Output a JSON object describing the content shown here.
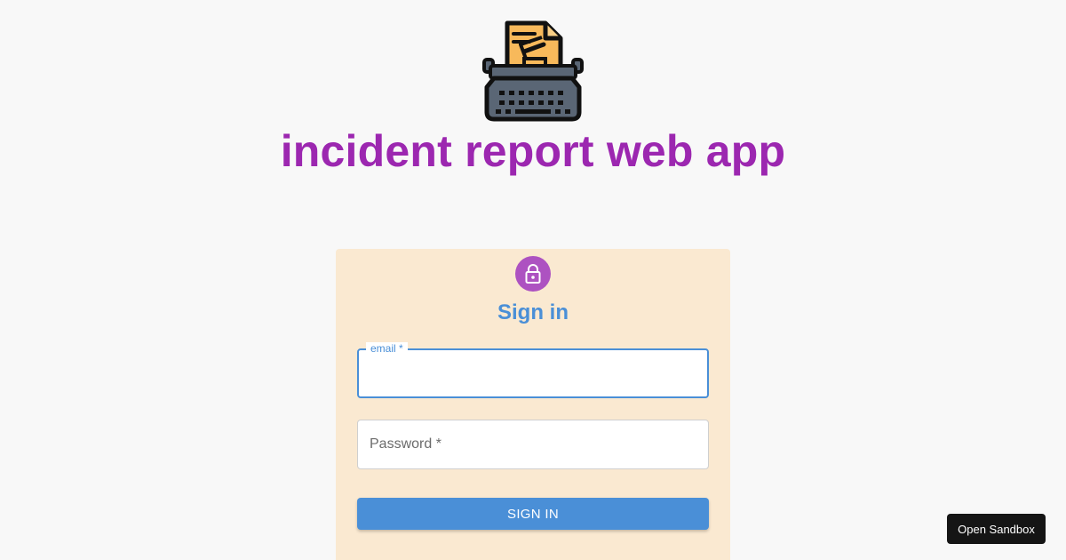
{
  "header": {
    "logo_icon": "typewriter-icon",
    "title": "incident report web app"
  },
  "signin_card": {
    "lock_icon": "lock-icon",
    "title": "Sign in",
    "email_label": "email *",
    "email_value": "",
    "password_label": "Password *",
    "password_value": "",
    "submit_label": "SIGN IN"
  },
  "sandbox": {
    "label": "Open Sandbox"
  },
  "colors": {
    "page_background": "#f8f8f8",
    "title": "#9c27b0",
    "card_background": "#fae9d1",
    "accent_blue": "#4a8fd7",
    "avatar": "#ad52c1",
    "sandbox_button": "#151515"
  }
}
